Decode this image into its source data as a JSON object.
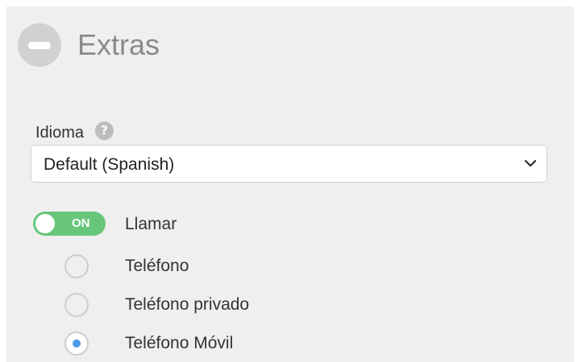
{
  "section": {
    "title": "Extras"
  },
  "language": {
    "label": "Idioma",
    "help_glyph": "?",
    "selected": "Default (Spanish)"
  },
  "call_toggle": {
    "state_text": "ON",
    "label": "Llamar",
    "on_color": "#67c67a"
  },
  "phone_options": [
    {
      "label": "Teléfono",
      "checked": false
    },
    {
      "label": "Teléfono privado",
      "checked": false
    },
    {
      "label": "Teléfono Móvil",
      "checked": true
    }
  ],
  "colors": {
    "panel_background": "#efefef",
    "radio_selected": "#4a9ae6"
  }
}
